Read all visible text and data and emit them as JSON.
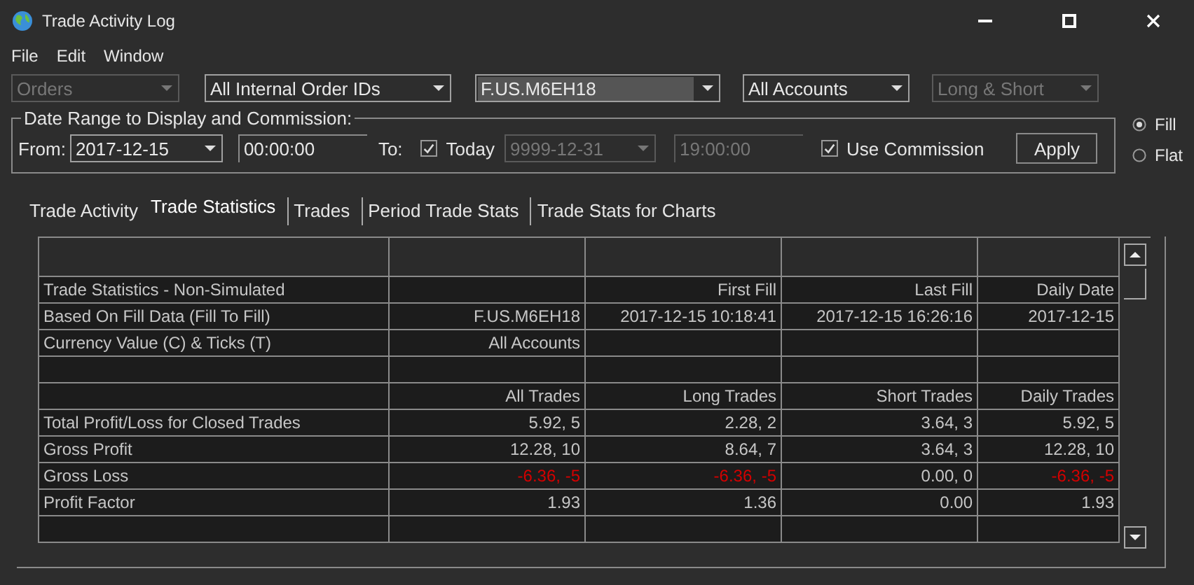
{
  "window": {
    "title": "Trade Activity Log"
  },
  "menu": [
    "File",
    "Edit",
    "Window"
  ],
  "filters": [
    {
      "value": "Orders",
      "disabled": true,
      "highlighted": false
    },
    {
      "value": "All Internal Order IDs",
      "disabled": false,
      "highlighted": false
    },
    {
      "value": "F.US.M6EH18",
      "disabled": false,
      "highlighted": true
    },
    {
      "value": "All Accounts",
      "disabled": false,
      "highlighted": false
    },
    {
      "value": "Long & Short",
      "disabled": true,
      "highlighted": false
    }
  ],
  "date_range": {
    "legend": "Date Range to Display and Commission:",
    "from_label": "From:",
    "from_date": "2017-12-15",
    "from_time": "00:00:00",
    "to_label": "To:",
    "today": {
      "label": "Today",
      "checked": true
    },
    "to_date": {
      "value": "9999-12-31",
      "disabled": true
    },
    "to_time": {
      "value": "19:00:00",
      "disabled": true
    },
    "commission": {
      "label": "Use Commission",
      "checked": true
    },
    "apply": "Apply"
  },
  "radios": [
    {
      "label": "Fill",
      "selected": true
    },
    {
      "label": "Flat",
      "selected": false
    }
  ],
  "tabs": [
    {
      "label": "Trade Activity",
      "selected": false
    },
    {
      "label": "Trade Statistics",
      "selected": true
    },
    {
      "label": "Trades",
      "selected": false
    },
    {
      "label": "Period Trade Stats",
      "selected": false
    },
    {
      "label": "Trade Stats for Charts",
      "selected": false
    }
  ],
  "table": {
    "rows": [
      {
        "kind": "blank"
      },
      {
        "kind": "data",
        "cells": [
          "Trade Statistics - Non-Simulated",
          "",
          "First Fill",
          "Last Fill",
          "Daily Date"
        ]
      },
      {
        "kind": "data",
        "cells": [
          "Based On Fill Data (Fill To Fill)",
          "F.US.M6EH18",
          "2017-12-15  10:18:41",
          "2017-12-15  16:26:16",
          "2017-12-15"
        ]
      },
      {
        "kind": "data",
        "cells": [
          "Currency Value (C) & Ticks (T)",
          "All Accounts",
          "",
          "",
          ""
        ]
      },
      {
        "kind": "blank"
      },
      {
        "kind": "data",
        "cells": [
          "",
          "All Trades",
          "Long Trades",
          "Short Trades",
          "Daily Trades"
        ]
      },
      {
        "kind": "data",
        "cells": [
          "Total Profit/Loss for Closed Trades",
          "5.92, 5",
          "2.28, 2",
          "3.64, 3",
          "5.92, 5"
        ]
      },
      {
        "kind": "data",
        "cells": [
          "Gross Profit",
          "12.28, 10",
          "8.64, 7",
          "3.64, 3",
          "12.28, 10"
        ]
      },
      {
        "kind": "data",
        "cells": [
          "Gross Loss",
          {
            "text": "-6.36, -5",
            "negative": true
          },
          {
            "text": "-6.36, -5",
            "negative": true
          },
          "0.00, 0",
          {
            "text": "-6.36, -5",
            "negative": true
          }
        ]
      },
      {
        "kind": "data",
        "cells": [
          "Profit Factor",
          "1.93",
          "1.36",
          "0.00",
          "1.93"
        ]
      },
      {
        "kind": "blank"
      }
    ]
  }
}
